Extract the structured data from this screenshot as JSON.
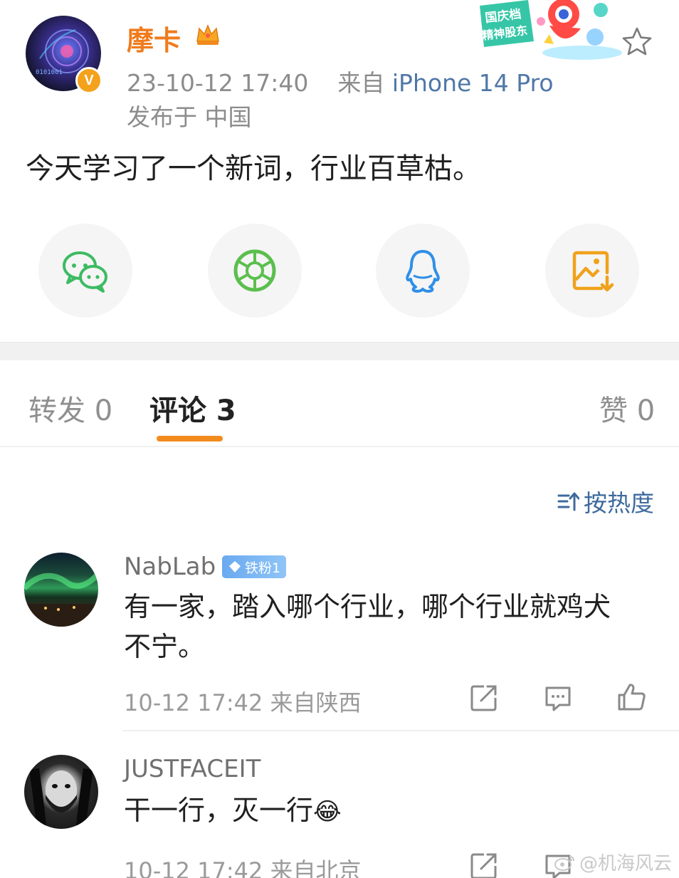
{
  "post": {
    "author_name": "摩卡",
    "verified_mark": "V",
    "crown_icon": "crown-icon",
    "time": "23-10-12 17:40",
    "source_prefix": "来自",
    "device": "iPhone 14 Pro",
    "location": "发布于 中国",
    "text": "今天学习了一个新词，行业百草枯。",
    "promo_line1": "国庆档",
    "promo_line2": "精神股东"
  },
  "share": {
    "items": [
      {
        "icon": "wechat-icon",
        "color": "#3dbb63"
      },
      {
        "icon": "moments-icon",
        "color": "#5bbf4e"
      },
      {
        "icon": "qq-icon",
        "color": "#2f8fe8"
      },
      {
        "icon": "save-image-icon",
        "color": "#f0a21c"
      }
    ]
  },
  "tabs": {
    "repost": "转发 0",
    "comments": "评论 3",
    "likes": "赞 0"
  },
  "sort": {
    "label": "按热度"
  },
  "comments": [
    {
      "name": "NabLab",
      "badge": "铁粉1",
      "text_line1": "有一家，踏入哪个行业，哪个行业就鸡犬",
      "text_line2": "不宁。",
      "time": "10-12 17:42  来自陕西"
    },
    {
      "name": "JUSTFACEIT",
      "text": "干一行，灭一行",
      "emoji": "😂",
      "time": "10-12 17:42  来自北京"
    }
  ],
  "watermark": "@机海风云",
  "colors": {
    "accent_orange": "#f28b1e",
    "link_blue": "#3d6a9c"
  }
}
